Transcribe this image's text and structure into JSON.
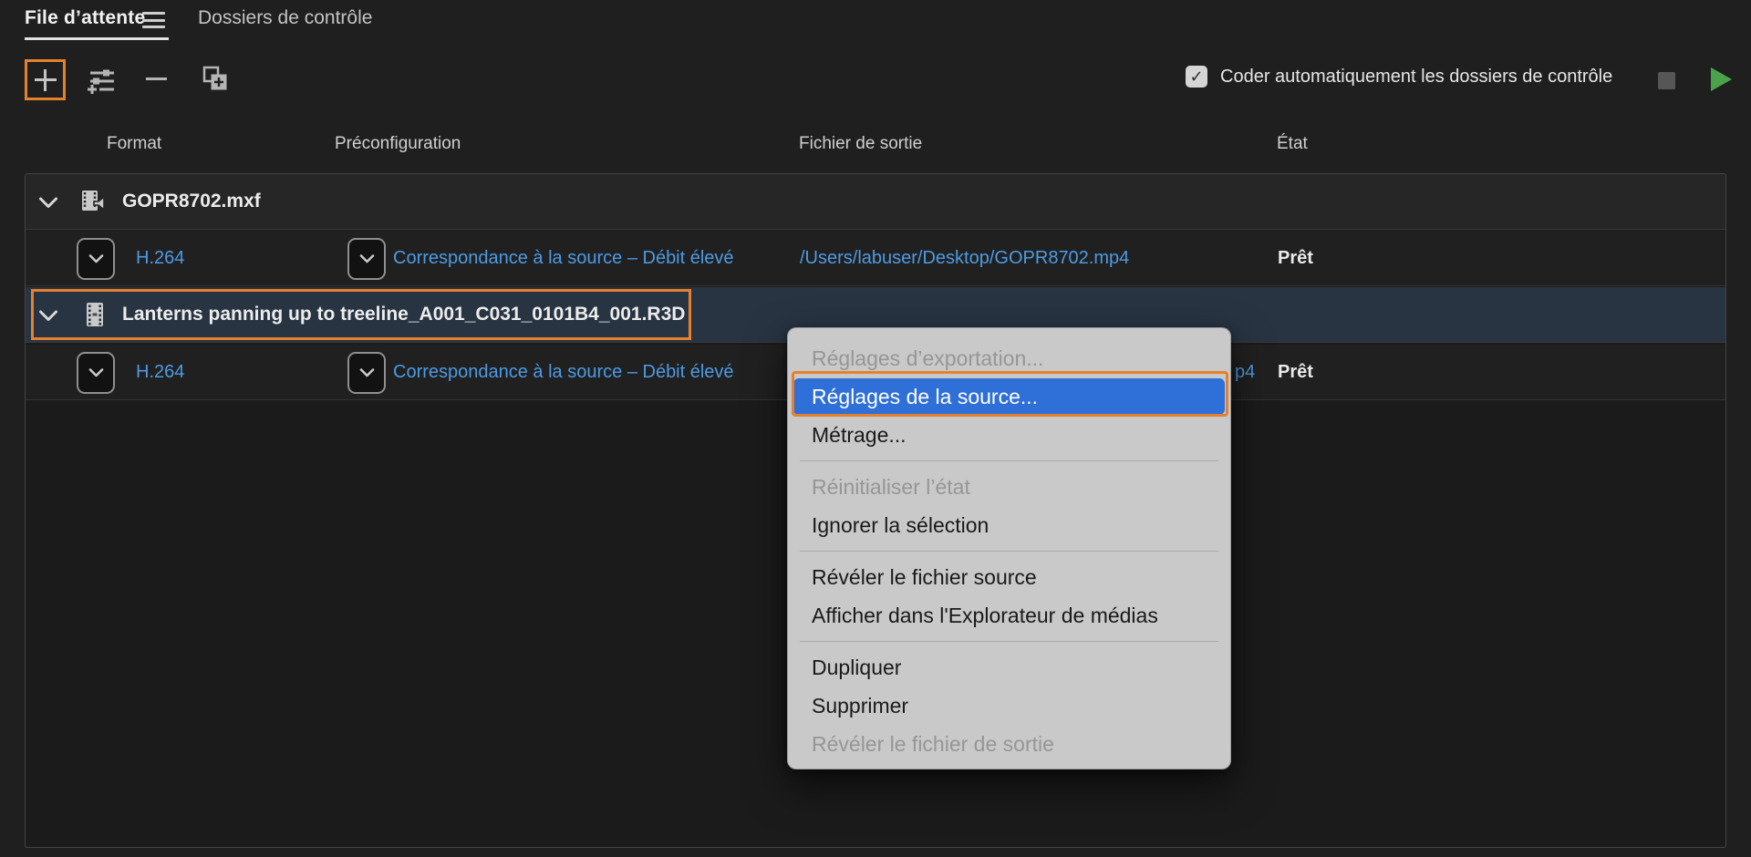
{
  "tabs": {
    "queue": "File d’attente",
    "watch_folders": "Dossiers de contrôle"
  },
  "toolbar": {
    "auto_encode_label": "Coder automatiquement les dossiers de contrôle",
    "checkbox_checked": true,
    "check_glyph": "✓"
  },
  "columns": {
    "format": "Format",
    "preset": "Préconfiguration",
    "output_file": "Fichier de sortie",
    "status": "État"
  },
  "queue": {
    "groups": [
      {
        "name": "GOPR8702.mxf",
        "icon": "video-audio-clip-icon",
        "selected": false,
        "outputs": [
          {
            "format": "H.264",
            "preset": "Correspondance à la source – Débit élevé",
            "output_file": "/Users/labuser/Desktop/GOPR8702.mp4",
            "status": "Prêt"
          }
        ]
      },
      {
        "name": "Lanterns panning up to treeline_A001_C031_0101B4_001.R3D",
        "icon": "film-clip-icon",
        "selected": true,
        "outputs": [
          {
            "format": "H.264",
            "preset": "Correspondance à la source – Débit élevé",
            "output_file_visible_tail": "p4",
            "status": "Prêt"
          }
        ]
      }
    ]
  },
  "context_menu": {
    "items": [
      {
        "label": "Réglages d’exportation...",
        "state": "disabled"
      },
      {
        "label": "Réglages de la source...",
        "state": "highlighted"
      },
      {
        "label": "Métrage...",
        "state": "normal"
      },
      {
        "label": "Réinitialiser l’état",
        "state": "disabled"
      },
      {
        "label": "Ignorer la sélection",
        "state": "normal"
      },
      {
        "label": "Révéler le fichier source",
        "state": "normal"
      },
      {
        "label": "Afficher dans l'Explorateur de médias",
        "state": "normal"
      },
      {
        "label": "Dupliquer",
        "state": "normal"
      },
      {
        "label": "Supprimer",
        "state": "normal"
      },
      {
        "label": "Révéler le fichier de sortie",
        "state": "disabled"
      }
    ]
  },
  "colors": {
    "annotation_orange": "#e5812e",
    "menu_highlight_blue": "#2e6fd8",
    "link_blue": "#4d9be4",
    "play_green": "#4aa34a",
    "selected_row": "#283442"
  }
}
